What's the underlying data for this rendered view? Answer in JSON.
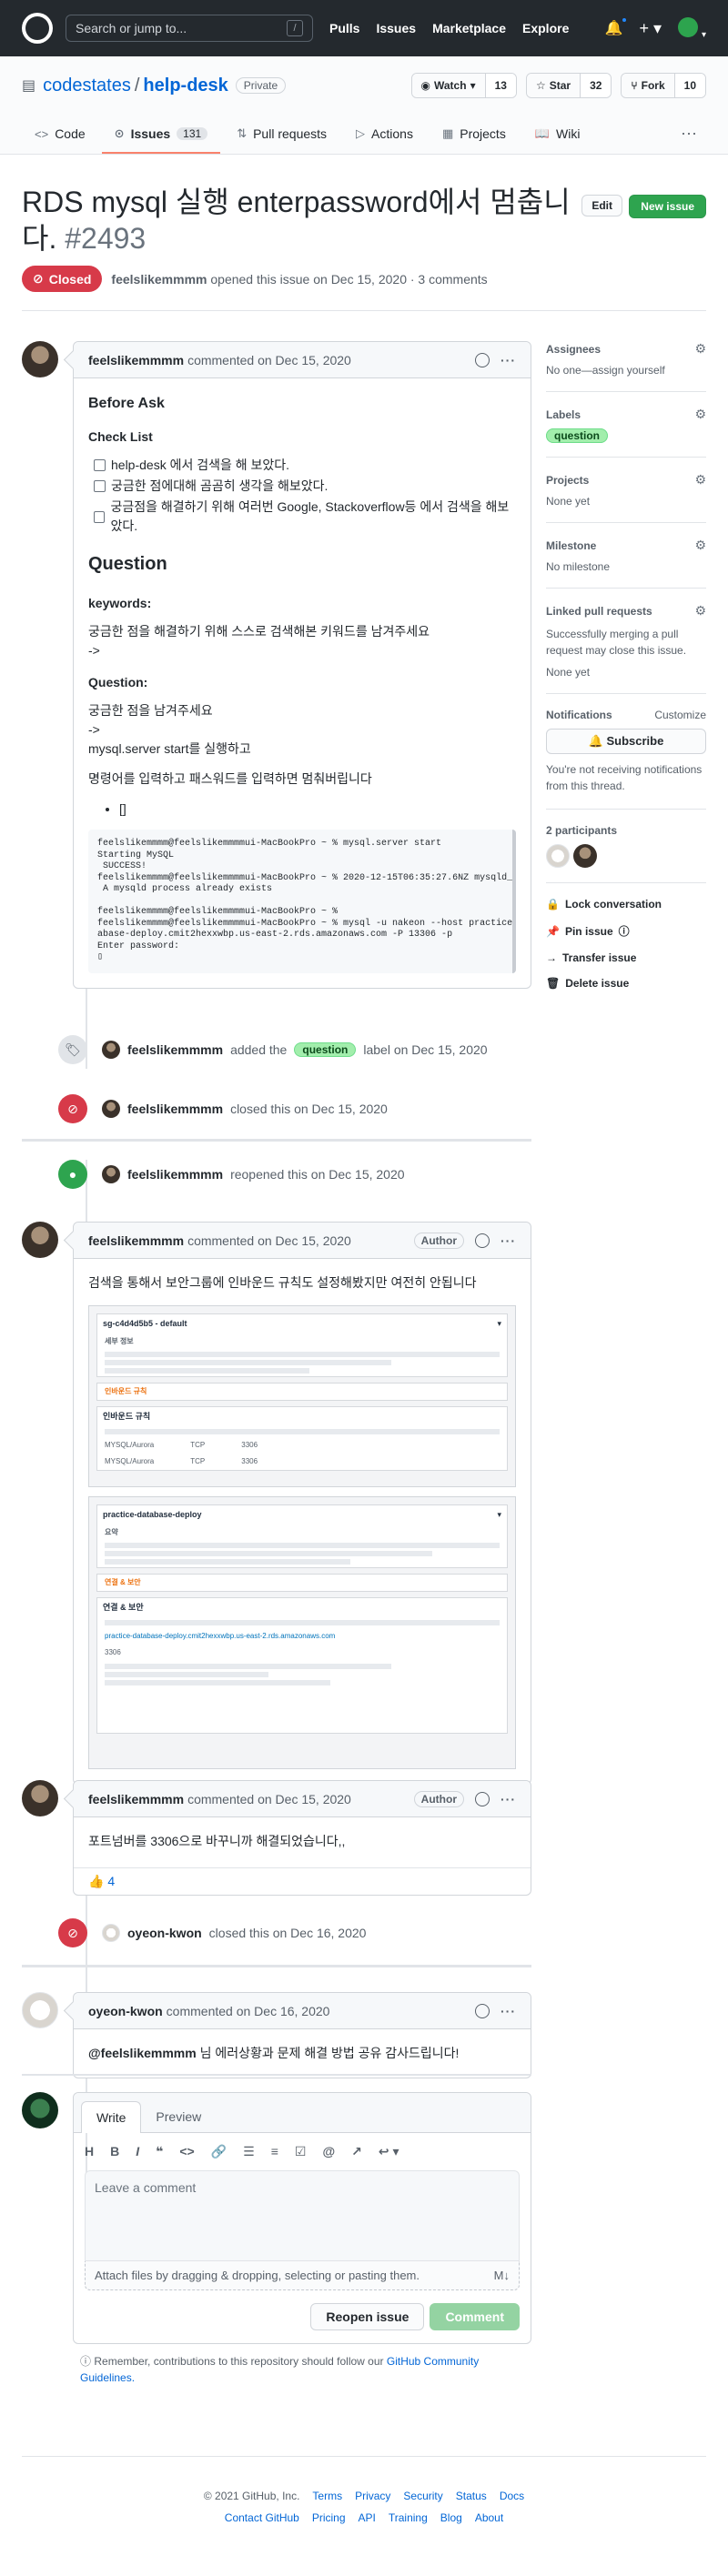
{
  "header": {
    "search_placeholder": "Search or jump to...",
    "search_key": "/",
    "nav": [
      "Pulls",
      "Issues",
      "Marketplace",
      "Explore"
    ]
  },
  "repo": {
    "owner": "codestates",
    "name": "help-desk",
    "visibility": "Private",
    "watch_label": "Watch",
    "watch_count": "13",
    "star_label": "Star",
    "star_count": "32",
    "fork_label": "Fork",
    "fork_count": "10",
    "tabs": [
      {
        "label": "Code"
      },
      {
        "label": "Issues",
        "count": "131"
      },
      {
        "label": "Pull requests"
      },
      {
        "label": "Actions"
      },
      {
        "label": "Projects"
      },
      {
        "label": "Wiki"
      }
    ]
  },
  "issue": {
    "title": "RDS mysql 실행 enterpassword에서 멈춥니다.",
    "number": "#2493",
    "edit_label": "Edit",
    "new_label": "New issue",
    "state": "Closed",
    "author": "feelslikemmmm",
    "meta_text": "opened this issue on Dec 15, 2020 · 3 comments"
  },
  "comment1": {
    "author": "feelslikemmmm",
    "when": "commented on Dec 15, 2020",
    "h_before": "Before Ask",
    "h_check": "Check List",
    "checks": [
      "help-desk 에서 검색을 해 보았다.",
      "궁금한 점에대해 곰곰히 생각을 해보았다.",
      "궁금점을 해결하기 위해 여러번 Google, Stackoverflow등 에서 검색을 해보았다."
    ],
    "h_question": "Question",
    "h_keywords": "keywords:",
    "kw_text": "궁금한 점을 해결하기 위해 스스로 검색해본 키워드를 남겨주세요",
    "arrow": "->",
    "h_q2": "Question:",
    "q_text": "궁금한 점을 남겨주세요",
    "q_arrow": "->",
    "q_line": "mysql.server start를 실행하고",
    "p_line": "명령어를 입력하고 패스워드를 입력하면 멈춰버립니다",
    "bullet": "[]",
    "code": "feelslikemmmm@feelslikemmmmui-MacBookPro ~ % mysql.server start\nStarting MySQL\n SUCCESS!\nfeelslikemmmm@feelslikemmmmui-MacBookPro ~ % 2020-12-15T06:35:27.6NZ mysqld_safe\n A mysqld process already exists\n\nfeelslikemmmm@feelslikemmmmui-MacBookPro ~ %\nfeelslikemmmm@feelslikemmmmui-MacBookPro ~ % mysql -u nakeon --host practice-dat\nabase-deploy.cmit2hexxwbp.us-east-2.rds.amazonaws.com -P 13306 -p\nEnter password:\n▯"
  },
  "events": {
    "labeled": {
      "actor": "feelslikemmmm",
      "pre": "added the",
      "label": "question",
      "post": "label on Dec 15, 2020"
    },
    "closed1": {
      "actor": "feelslikemmmm",
      "text": "closed this on Dec 15, 2020"
    },
    "reopened": {
      "actor": "feelslikemmmm",
      "text": "reopened this on Dec 15, 2020"
    },
    "closed2": {
      "actor": "oyeon-kwon",
      "text": "closed this on Dec 16, 2020"
    }
  },
  "comment2": {
    "author": "feelslikemmmm",
    "when": "commented on Dec 15, 2020",
    "role": "Author",
    "text": "검색을 통해서 보안그룹에 인바운드 규칙도 설정해봤지만 여전히 안됩니다",
    "shot1_title": "sg-c4d4d5b5 - default",
    "shot1_sub": "세부 정보",
    "shot1_tab": "인바운드 규칙",
    "shot1_table": "인바운드 규칙",
    "shot1_rowa": "MYSQL/Aurora",
    "shot1_rowb": "MYSQL/Aurora",
    "shot1_port": "3306",
    "shot2_title": "practice-database-deploy",
    "shot2_sub": "요약",
    "shot2_tab": "연결 & 보안",
    "shot2_section": "연결 & 보안",
    "shot2_port": "3306"
  },
  "comment3": {
    "author": "feelslikemmmm",
    "when": "commented on Dec 15, 2020",
    "role": "Author",
    "text": "포트넘버를 3306으로 바꾸니까 해결되었습니다,,",
    "reaction": "👍",
    "reaction_count": "4"
  },
  "comment4": {
    "author": "oyeon-kwon",
    "when": "commented on Dec 16, 2020",
    "mention": "@feelslikemmmm",
    "text": " 님 에러상황과 문제 해결 방법 공유 감사드립니다!"
  },
  "form": {
    "tab_write": "Write",
    "tab_preview": "Preview",
    "placeholder": "Leave a comment",
    "attach": "Attach files by dragging & dropping, selecting or pasting them.",
    "reopen_label": "Reopen issue",
    "comment_label": "Comment",
    "remember": "Remember, contributions to this repository should follow our",
    "guidelines": "GitHub Community Guidelines."
  },
  "sidebar": {
    "assignees_h": "Assignees",
    "assignees_v": "No one—assign yourself",
    "labels_h": "Labels",
    "labels_v": "question",
    "projects_h": "Projects",
    "projects_v": "None yet",
    "milestone_h": "Milestone",
    "milestone_v": "No milestone",
    "linked_h": "Linked pull requests",
    "linked_desc": "Successfully merging a pull request may close this issue.",
    "linked_v": "None yet",
    "notif_h": "Notifications",
    "notif_customize": "Customize",
    "subscribe": "Subscribe",
    "notif_desc": "You're not receiving notifications from this thread.",
    "participants_h": "2 participants",
    "lock": "Lock conversation",
    "pin": "Pin issue",
    "transfer": "Transfer issue",
    "delete": "Delete issue"
  },
  "footer": {
    "copyright": "© 2021 GitHub, Inc.",
    "row1": [
      "Terms",
      "Privacy",
      "Security",
      "Status",
      "Docs"
    ],
    "row2": [
      "Contact GitHub",
      "Pricing",
      "API",
      "Training",
      "Blog",
      "About"
    ]
  }
}
